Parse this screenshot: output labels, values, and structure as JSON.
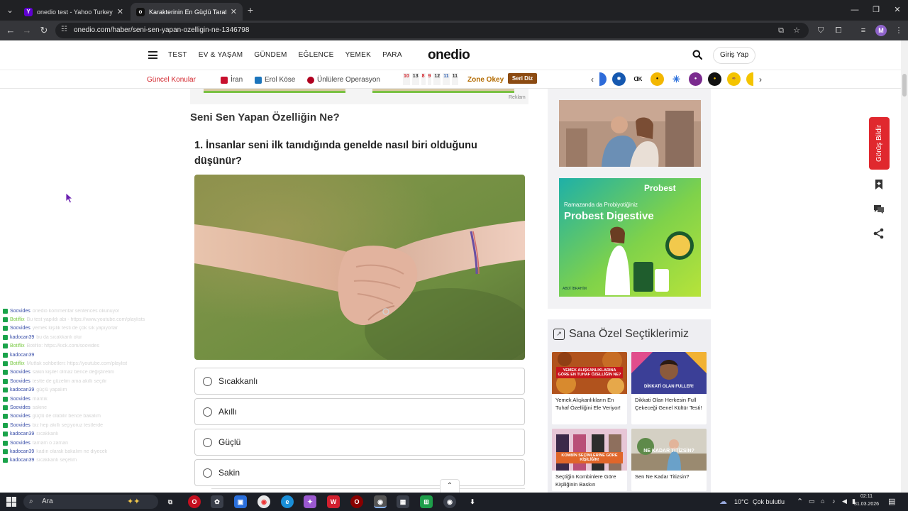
{
  "browser": {
    "tabs": [
      {
        "title": "onedio test - Yahoo Turkey Ara",
        "favicon": "yahoo-icon"
      },
      {
        "title": "Karakterinin En Güçlü Tarafını S",
        "favicon": "onedio-icon"
      }
    ],
    "new_tab": "+",
    "url": "onedio.com/haber/seni-sen-yapan-ozelligin-ne-1346798",
    "profile_initial": "M"
  },
  "site": {
    "logo": "onedio",
    "nav": [
      "TEST",
      "EV & YAŞAM",
      "GÜNDEM",
      "EĞLENCE",
      "YEMEK",
      "PARA"
    ],
    "login": "Giriş Yap",
    "subnav": {
      "gundem": "Güncel Konular",
      "topics": [
        "İran",
        "Erol Köse",
        "Ünlülere Operasyon"
      ],
      "dates": [
        "10",
        "13",
        "8",
        "9",
        "12",
        "11",
        "11"
      ],
      "zone": "Zone Okey",
      "seri_diz": "Seri Diz"
    }
  },
  "article": {
    "ad_label": "Reklam",
    "title": "Seni Sen Yapan Özelliğin Ne?",
    "question": "1. İnsanlar seni ilk tanıdığında genelde nasıl biri olduğunu düşünür?",
    "options": [
      "Sıcakkanlı",
      "Akıllı",
      "Güçlü",
      "Sakin"
    ]
  },
  "sidebar": {
    "probest": {
      "brand": "Probest",
      "sub": "Ramazanda da Probiyotiğiniz",
      "product": "Probest Digestive",
      "maker": "ABDİ İBRAHİM"
    },
    "ozel_title": "Sana Özel Seçtiklerimiz",
    "cards": [
      {
        "caption": "Yemek Alışkanlıkların En Tuhaf Özelliğini Ele Veriyor!",
        "overlay": "YEMEK ALIŞKANLIKLARINA GÖRE EN TUHAF ÖZELLİĞİN NE?"
      },
      {
        "caption": "Dikkati Olan Herkesin Full Çekeceği Genel Kültür Testi!",
        "overlay": "DİKKATİ OLAN FULLER!"
      },
      {
        "caption": "Seçtiğin Kombinlere Göre Kişiliğinin Baskın",
        "overlay": "KOMBİN SEÇİMLERİNE GÖRE KİŞİLİĞİN!"
      },
      {
        "caption": "Sen Ne Kadar Titizsin?",
        "overlay": "NE KADAR TİTİZSİN?"
      }
    ]
  },
  "floating": {
    "feedback": "Görüş Bildir"
  },
  "chat": [
    {
      "user": "Soovides",
      "msg": "onedio kommentar sentences okunuyor",
      "green": false
    },
    {
      "user": "Botiflix",
      "msg": "Bu test yapıldı abi - https://www.youtube.com/playlists",
      "green": true
    },
    {
      "user": "Soovides",
      "msg": "yemek kişilik testi de çok sık yapıyorlar",
      "green": false
    },
    {
      "user": "kadocan39",
      "msg": "bu da sıcakkanlı olur",
      "green": false
    },
    {
      "user": "Botiflix",
      "msg": "Botiflix: https://kick.com/soovides",
      "green": true
    },
    {
      "user": "kadocan39",
      "msg": "",
      "green": false
    },
    {
      "user": "Botiflix",
      "msg": "Mutfak sohbetleri: https://youtube.com/playlist",
      "green": true
    },
    {
      "user": "Soovides",
      "msg": "sakin kişiler olmaz bence değiştirelim",
      "green": false
    },
    {
      "user": "Soovides",
      "msg": "testte de güzelim ama akıllı seçilir",
      "green": false
    },
    {
      "user": "kadocan39",
      "msg": "güçlü yapalım",
      "green": false
    },
    {
      "user": "Soovides",
      "msg": "mantık",
      "green": false
    },
    {
      "user": "Soovides",
      "msg": "sakine",
      "green": false
    },
    {
      "user": "Soovides",
      "msg": "güçlü de olabilir bence bakalım",
      "green": false
    },
    {
      "user": "Soovides",
      "msg": "biz hep akıllı seçiyoruz testlerde",
      "green": false
    },
    {
      "user": "kadocan39",
      "msg": "sıcakkanlı",
      "green": false
    },
    {
      "user": "Soovides",
      "msg": "tamam o zaman",
      "green": false
    },
    {
      "user": "kadocan39",
      "msg": "kadın olarak bakalım ne diyecek",
      "green": false
    },
    {
      "user": "kadocan39",
      "msg": "sıcakkanlı seçelim",
      "green": false
    }
  ],
  "taskbar": {
    "search": "Ara",
    "weather": "10°C",
    "weather_desc": "Çok bulutlu",
    "time": "02:11",
    "date": "31.03.2026"
  }
}
